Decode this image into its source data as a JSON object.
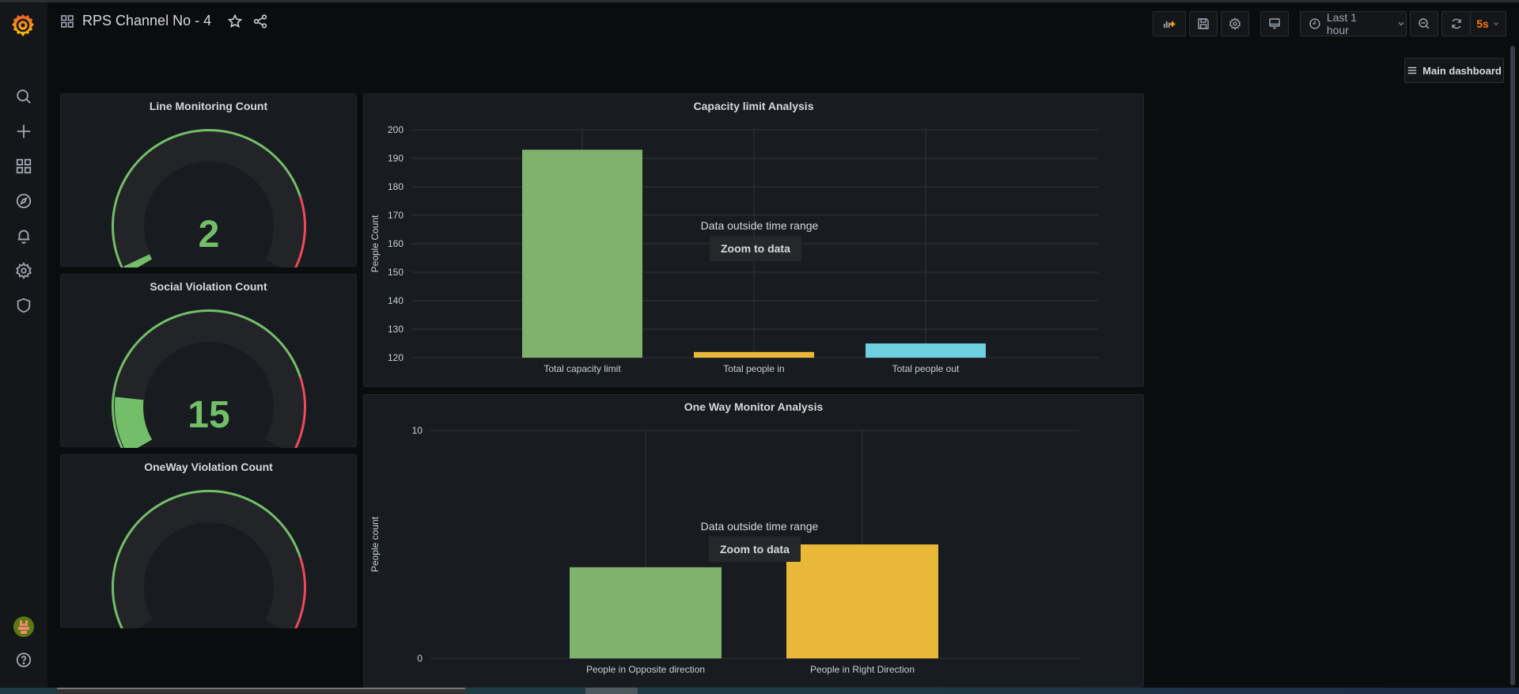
{
  "header": {
    "title": "RPS Channel No - 4",
    "icons": [
      "dashboards-grid-icon",
      "star-icon",
      "share-icon"
    ]
  },
  "toolbar": {
    "add_panel": "add-panel-icon",
    "save": "save-icon",
    "settings": "gear-icon",
    "tv_mode": "monitor-icon",
    "time_range_label": "Last 1 hour",
    "zoom_out": "zoom-out-icon",
    "refresh": "refresh-icon",
    "refresh_interval": "5s"
  },
  "sidebar": {
    "items": [
      {
        "name": "search",
        "icon": "search-icon"
      },
      {
        "name": "create",
        "icon": "plus-icon"
      },
      {
        "name": "dashboards",
        "icon": "dashboards-icon"
      },
      {
        "name": "explore",
        "icon": "compass-icon"
      },
      {
        "name": "alerting",
        "icon": "bell-icon"
      },
      {
        "name": "configuration",
        "icon": "gear-icon"
      },
      {
        "name": "server-admin",
        "icon": "shield-icon"
      }
    ],
    "bottom": [
      "avatar",
      "help-icon"
    ]
  },
  "main_dashboard_button": "Main dashboard",
  "colors": {
    "green": "#73bf69",
    "red": "#f2495c",
    "bar_green": "#7eb26d",
    "bar_yellow": "#eab839",
    "bar_cyan": "#6ed0e0",
    "orange_accent": "#ff780a"
  },
  "gauges": [
    {
      "title": "Line Monitoring Count",
      "value": 2,
      "display": "2",
      "min": 0,
      "max": 100,
      "threshold": 80
    },
    {
      "title": "Social Violation Count",
      "value": 15,
      "display": "15",
      "min": 0,
      "max": 100,
      "threshold": 80
    },
    {
      "title": "OneWay Violation Count",
      "value": null,
      "display": "",
      "min": 0,
      "max": 100,
      "threshold": 80
    }
  ],
  "no_data_message": "Data outside time range",
  "zoom_to_data_label": "Zoom to data",
  "chart_data": [
    {
      "type": "bar",
      "title": "Capacity limit Analysis",
      "xlabel": "",
      "ylabel": "People Count",
      "categories": [
        "Total capacity limit",
        "Total people in",
        "Total people out"
      ],
      "values": [
        193,
        122,
        125
      ],
      "colors": [
        "#7eb26d",
        "#eab839",
        "#6ed0e0"
      ],
      "ylim": [
        120,
        200
      ],
      "yticks": [
        120,
        130,
        140,
        150,
        160,
        170,
        180,
        190,
        200
      ],
      "grid": true,
      "legend": "none"
    },
    {
      "type": "bar",
      "title": "One Way Monitor Analysis",
      "xlabel": "",
      "ylabel": "People count",
      "categories": [
        "People in Opposite direction",
        "People in Right Direction"
      ],
      "values": [
        4,
        5
      ],
      "colors": [
        "#7eb26d",
        "#eab839"
      ],
      "ylim": [
        0,
        10
      ],
      "yticks": [
        0,
        10
      ],
      "grid": true,
      "legend": "none"
    }
  ]
}
